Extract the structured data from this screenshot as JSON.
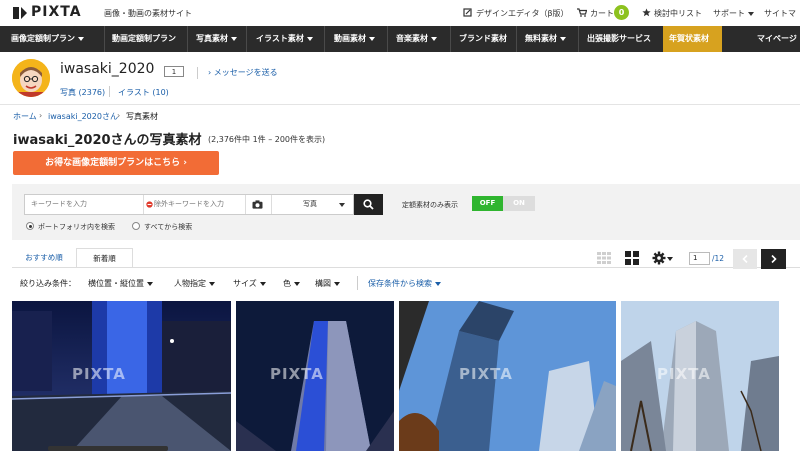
{
  "header": {
    "brand": "PIXTA",
    "tagline": "画像・動画の素材サイト",
    "links": {
      "design_editor": "デザインエディタ（β版）",
      "cart": "カート",
      "cart_count": "0",
      "wishlist": "検討中リスト",
      "support": "サポート",
      "sitemap": "サイトマ"
    }
  },
  "nav": {
    "items": [
      "画像定額制プラン",
      "動画定額制プラン",
      "写真素材",
      "イラスト素材",
      "動画素材",
      "音楽素材",
      "ブランド素材",
      "無料素材",
      "出張撮影サービス",
      "年賀状素材",
      "マイページ"
    ],
    "highlight_color": "#d7a21f"
  },
  "profile": {
    "name": "iwasaki_2020",
    "level": "1",
    "message_link": "メッセージを送る",
    "photo_count": "写真 (2376)",
    "illust_count": "イラスト (10)"
  },
  "breadcrumb": {
    "home": "ホーム",
    "user": "iwasaki_2020さん",
    "current": "写真素材"
  },
  "page": {
    "title": "iwasaki_2020さんの写真素材",
    "count": "(2,376件中 1件 – 200件を表示)",
    "promo_button": "お得な画像定額制プランはこちら"
  },
  "search": {
    "keyword_placeholder": "キーワードを入力",
    "exclude_placeholder": "除外キーワードを入力",
    "type_select": "写真",
    "flat_rate_label": "定額素材のみ表示",
    "toggle_off": "OFF",
    "toggle_on": "ON",
    "radio_portfolio": "ポートフォリオ内を検索",
    "radio_all": "すべてから検索"
  },
  "tabs": {
    "recommended": "おすすめ順",
    "newest": "新着順"
  },
  "pager": {
    "current": "1",
    "total": "/12"
  },
  "filters": {
    "label": "絞り込み条件：",
    "items": [
      "横位置・縦位置",
      "人物指定",
      "サイズ",
      "色",
      "構図"
    ],
    "saved": "保存条件から検索"
  },
  "photos": {
    "watermark": "PIXTA"
  },
  "colors": {
    "nav_bg": "#2b2b2b",
    "link": "#1a5ea8",
    "promo": "#f26c36",
    "toggle_off": "#2fb52f",
    "cart_badge": "#8dc21f"
  }
}
